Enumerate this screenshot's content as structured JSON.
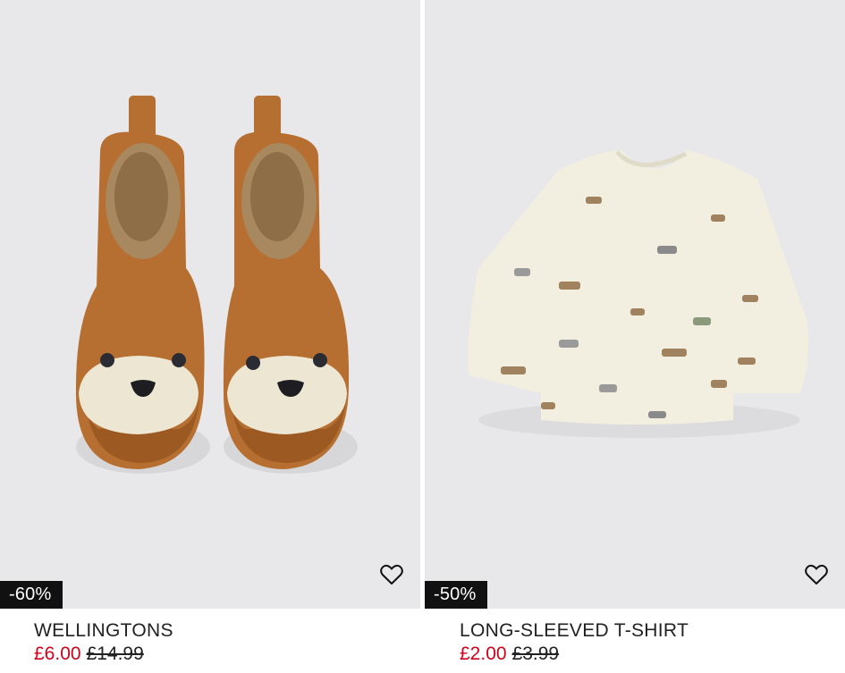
{
  "products": [
    {
      "name": "WELLINGTONS",
      "discount_badge": "-60%",
      "price_current": "£6.00",
      "price_original": "£14.99",
      "favourite_icon": "heart-outline-icon"
    },
    {
      "name": "LONG-SLEEVED T-SHIRT",
      "discount_badge": "-50%",
      "price_current": "£2.00",
      "price_original": "£3.99",
      "favourite_icon": "heart-outline-icon"
    }
  ],
  "colors": {
    "image_background": "#e8e8ea",
    "badge_background": "#111111",
    "sale_price": "#d0021b"
  }
}
